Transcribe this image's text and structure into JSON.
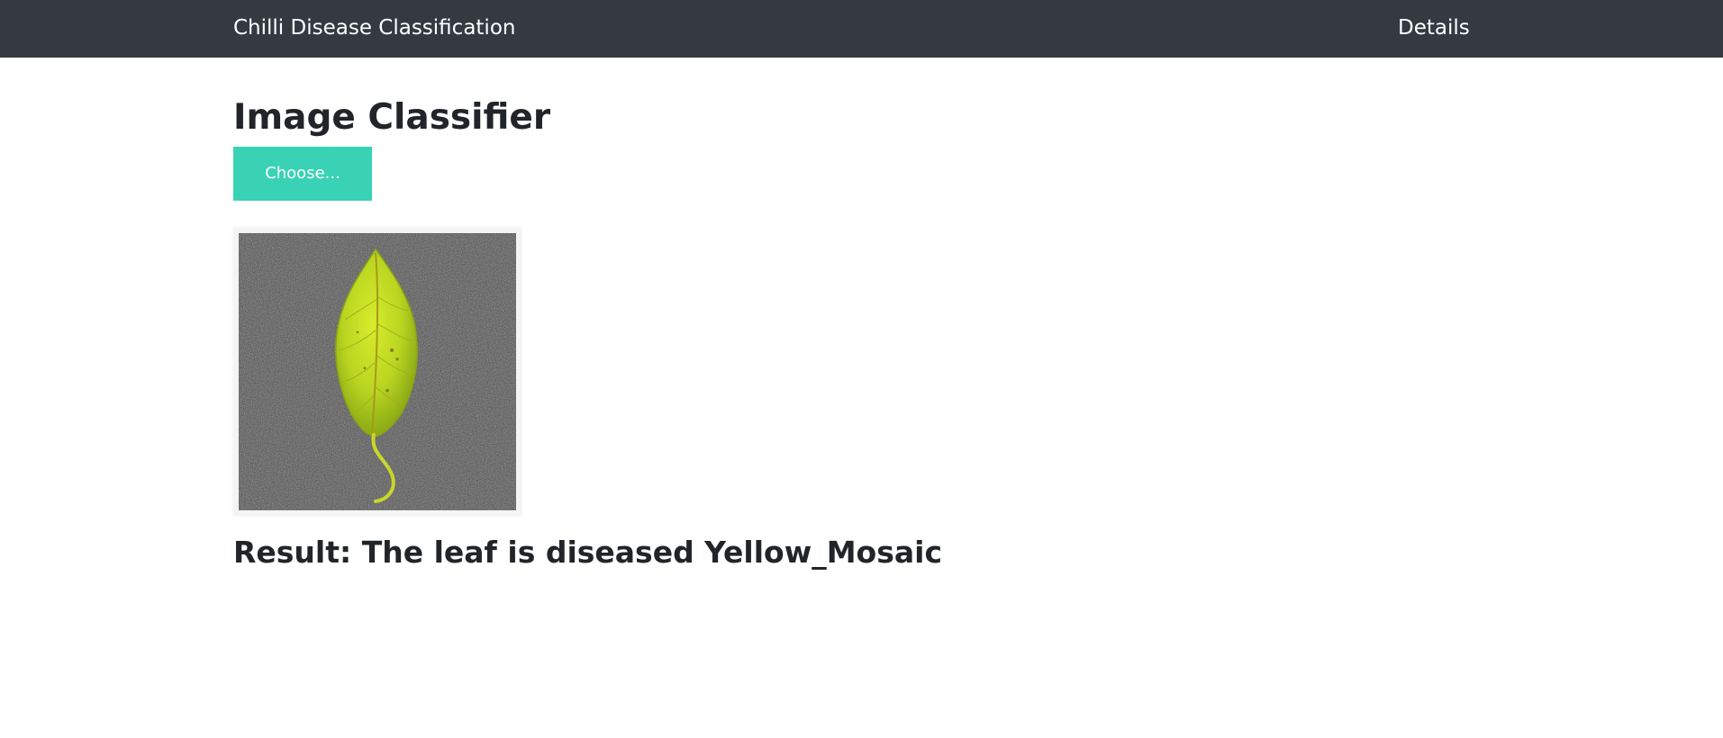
{
  "navbar": {
    "brand": "Chilli Disease Classification",
    "link_details": "Details",
    "background": "#343a40"
  },
  "main": {
    "title": "Image Classifier",
    "choose_button": "Choose...",
    "button_color": "#39d2b4",
    "result_text": "Result: The leaf is diseased Yellow_Mosaic"
  },
  "uploaded_image": {
    "subject": "yellow-green chilli leaf on dark gray fabric"
  }
}
